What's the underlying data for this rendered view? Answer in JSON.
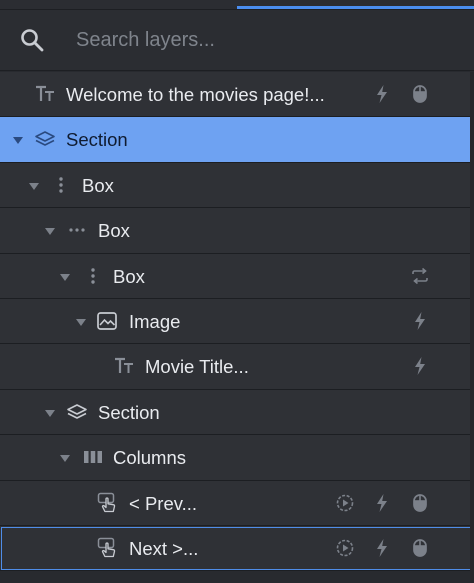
{
  "search": {
    "placeholder": "Search layers..."
  },
  "layers": [
    {
      "label": "Welcome to the movies page!...",
      "type": "text",
      "depth": 0,
      "caret": "none",
      "actions": [
        "lightning-icon",
        "mouse-icon"
      ]
    },
    {
      "label": "Section",
      "type": "section",
      "depth": 0,
      "caret": "down",
      "selected": true,
      "actions": []
    },
    {
      "label": "Box",
      "type": "box-vertical",
      "depth": 1,
      "caret": "down",
      "actions": []
    },
    {
      "label": "Box",
      "type": "box-horizontal",
      "depth": 2,
      "caret": "down",
      "actions": []
    },
    {
      "label": "Box",
      "type": "box-vertical",
      "depth": 3,
      "caret": "down",
      "actions": [
        "repeat-icon"
      ]
    },
    {
      "label": "Image",
      "type": "image",
      "depth": 4,
      "caret": "down",
      "actions": [
        "lightning-icon"
      ]
    },
    {
      "label": "Movie Title...",
      "type": "text",
      "depth": 5,
      "caret": "none",
      "actions": [
        "lightning-icon"
      ]
    },
    {
      "label": "Section",
      "type": "section",
      "depth": 2,
      "caret": "down",
      "actions": []
    },
    {
      "label": "Columns",
      "type": "columns",
      "depth": 3,
      "caret": "down",
      "actions": []
    },
    {
      "label": "< Prev...",
      "type": "button",
      "depth": 5,
      "caret": "none",
      "actions": [
        "play-circle-icon",
        "lightning-icon",
        "mouse-icon"
      ]
    },
    {
      "label": "Next >...",
      "type": "button",
      "depth": 5,
      "caret": "none",
      "hovered": true,
      "actions": [
        "play-circle-icon",
        "lightning-icon",
        "mouse-icon"
      ]
    }
  ],
  "colors": {
    "accent": "#4a8ef0",
    "selected_row": "#6ea2f2",
    "row_bg": "#2f3136",
    "icon": "#8a8f98"
  }
}
